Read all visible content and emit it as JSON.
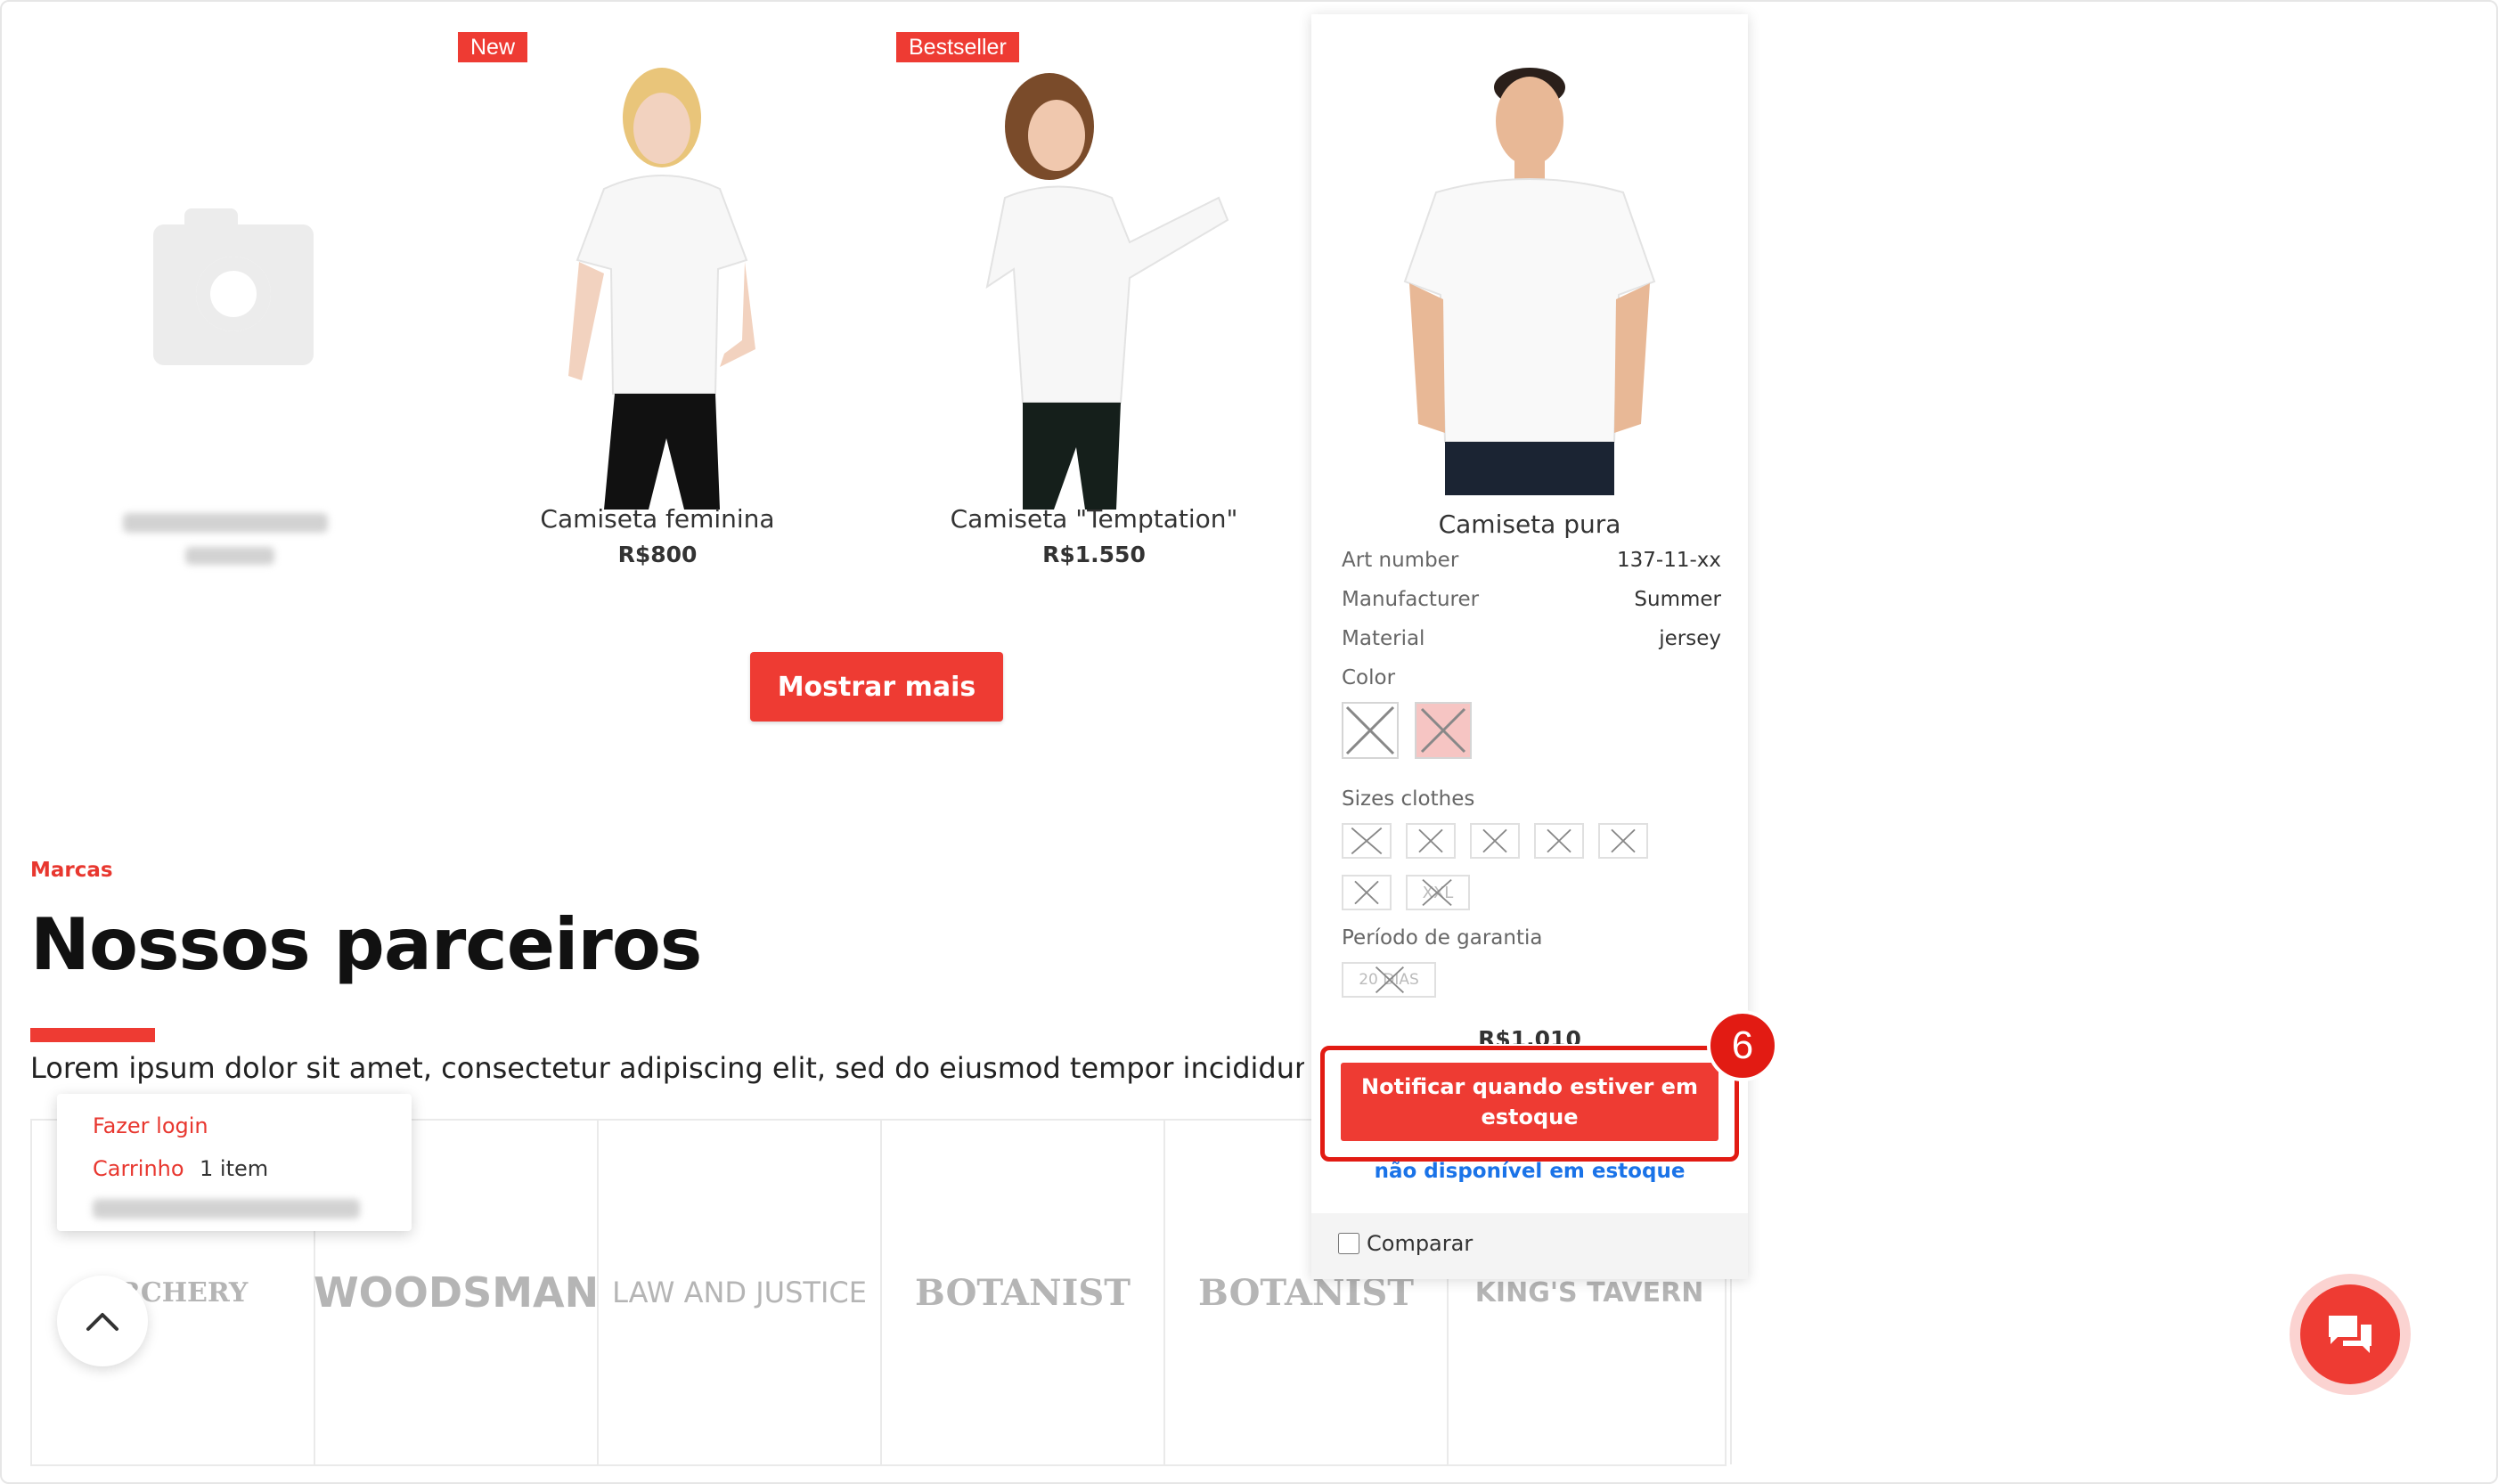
{
  "products": [
    {
      "name": "",
      "price": "",
      "badge": ""
    },
    {
      "name": "Camiseta feminina",
      "price": "R$800",
      "badge": "New"
    },
    {
      "name": "Camiseta \"Temptation\"",
      "price": "R$1.550",
      "badge": "Bestseller"
    }
  ],
  "show_more_label": "Mostrar mais",
  "hover_card": {
    "name": "Camiseta pura",
    "attributes": [
      {
        "label": "Art number",
        "value": "137-11-xx"
      },
      {
        "label": "Manufacturer",
        "value": "Summer"
      },
      {
        "label": "Material",
        "value": "jersey"
      }
    ],
    "color_label": "Color",
    "sizes_label": "Sizes clothes",
    "sizes": [
      "",
      "",
      "",
      "",
      "",
      "",
      "XXL"
    ],
    "warranty_label": "Período de garantia",
    "warranty_option": "20 DIAS",
    "price": "R$1.010",
    "notify_label": "Notificar quando estiver em estoque",
    "stock_status": "não disponível em estoque",
    "compare_label": "Comparar",
    "step_number": "6"
  },
  "brands_section": {
    "eyebrow": "Marcas",
    "title": "Nossos parceiros",
    "description": "Lorem ipsum dolor sit amet, consectetur adipiscing elit, sed do eiusmod tempor incididunt ut lab",
    "brands": [
      "ARCHERY",
      "WOODSMAN",
      "LAW AND JUSTICE",
      "BOTANIST",
      "BOTANIST",
      "KING'S TAVERN"
    ]
  },
  "account_menu": {
    "login_label": "Fazer login",
    "cart_label": "Carrinho",
    "cart_count": "1 item"
  },
  "colors": {
    "accent": "#ee3b33",
    "highlight": "#e21b13",
    "link_blue": "#1a73e8"
  },
  "icons": {
    "scroll_top": "chevron-up-icon",
    "chat": "chat-bubbles-icon",
    "placeholder": "camera-icon"
  }
}
